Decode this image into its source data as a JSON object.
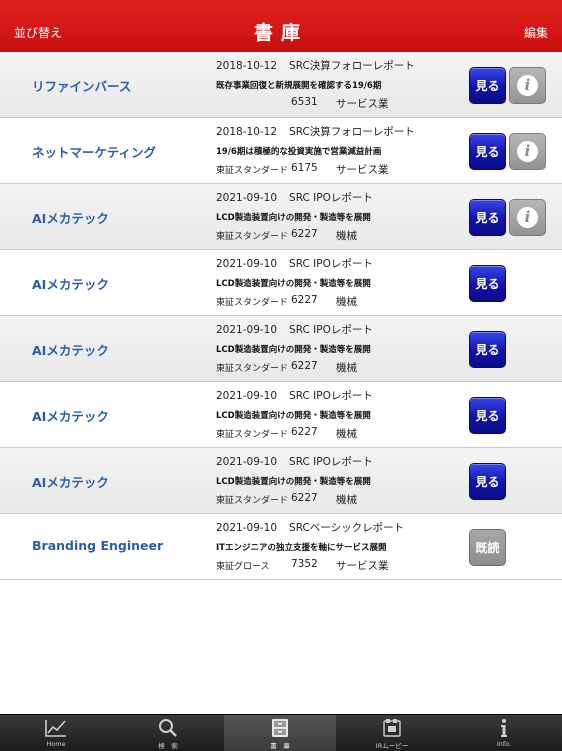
{
  "header": {
    "left_button": "並び替え",
    "title": "書庫",
    "right_button": "編集"
  },
  "buttons": {
    "view": "見る",
    "read": "既読",
    "info": "i"
  },
  "rows": [
    {
      "company": "リファインバース",
      "date": "2018-10-12",
      "report_type": "SRC決算フォローレポート",
      "headline": "既存事業回復と新規展開を確認する19/6期",
      "market": "",
      "code": "6531",
      "sector": "サービス業"
    },
    {
      "company": "ネットマーケティング",
      "date": "2018-10-12",
      "report_type": "SRC決算フォローレポート",
      "headline": "19/6期は積極的な投資実施で営業減益計画",
      "market": "東証スタンダード",
      "code": "6175",
      "sector": "サービス業"
    },
    {
      "company": "AIメカテック",
      "date": "2021-09-10",
      "report_type": "SRC IPOレポート",
      "headline": "LCD製造装置向けの開発・製造等を展開",
      "market": "東証スタンダード",
      "code": "6227",
      "sector": "機械"
    },
    {
      "company": "AIメカテック",
      "date": "2021-09-10",
      "report_type": "SRC IPOレポート",
      "headline": "LCD製造装置向けの開発・製造等を展開",
      "market": "東証スタンダード",
      "code": "6227",
      "sector": "機械"
    },
    {
      "company": "AIメカテック",
      "date": "2021-09-10",
      "report_type": "SRC IPOレポート",
      "headline": "LCD製造装置向けの開発・製造等を展開",
      "market": "東証スタンダード",
      "code": "6227",
      "sector": "機械"
    },
    {
      "company": "AIメカテック",
      "date": "2021-09-10",
      "report_type": "SRC IPOレポート",
      "headline": "LCD製造装置向けの開発・製造等を展開",
      "market": "東証スタンダード",
      "code": "6227",
      "sector": "機械"
    },
    {
      "company": "AIメカテック",
      "date": "2021-09-10",
      "report_type": "SRC IPOレポート",
      "headline": "LCD製造装置向けの開発・製造等を展開",
      "market": "東証スタンダード",
      "code": "6227",
      "sector": "機械"
    },
    {
      "company": "Branding Engineer",
      "date": "2021-09-10",
      "report_type": "SRCベーシックレポート",
      "headline": "ITエンジニアの独立支援を軸にサービス展開",
      "market": "東証グロース",
      "code": "7352",
      "sector": "サービス業"
    }
  ],
  "tabbar": {
    "tabs": [
      {
        "label": "Home",
        "icon": "chart-icon"
      },
      {
        "label": "検　索",
        "icon": "search-icon"
      },
      {
        "label": "書　庫",
        "icon": "cabinet-icon"
      },
      {
        "label": "IRムービー",
        "icon": "film-icon"
      },
      {
        "label": "Info.",
        "icon": "info-icon"
      }
    ]
  },
  "colors": {
    "header": "#d8191a",
    "company_text": "#2a5fa8",
    "view_button": "#1a1ab8"
  }
}
